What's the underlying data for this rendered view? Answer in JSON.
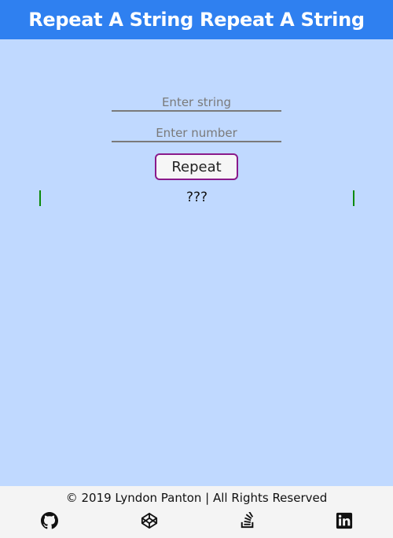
{
  "header": {
    "title": "Repeat A String Repeat A String"
  },
  "form": {
    "string_placeholder": "Enter string",
    "number_placeholder": "Enter number",
    "repeat_label": "Repeat"
  },
  "output": {
    "text": "???"
  },
  "footer": {
    "copyright": "© 2019 Lyndon Panton | All Rights Reserved",
    "links": [
      {
        "icon": "github-icon"
      },
      {
        "icon": "codepen-icon"
      },
      {
        "icon": "stackoverflow-icon"
      },
      {
        "icon": "linkedin-icon"
      }
    ]
  },
  "colors": {
    "header_bg": "#2f80f0",
    "page_bg": "#c0d9ff",
    "button_border": "#8a1a8a",
    "output_border": "#0a8a0a",
    "footer_bg": "#f4f4f4"
  }
}
